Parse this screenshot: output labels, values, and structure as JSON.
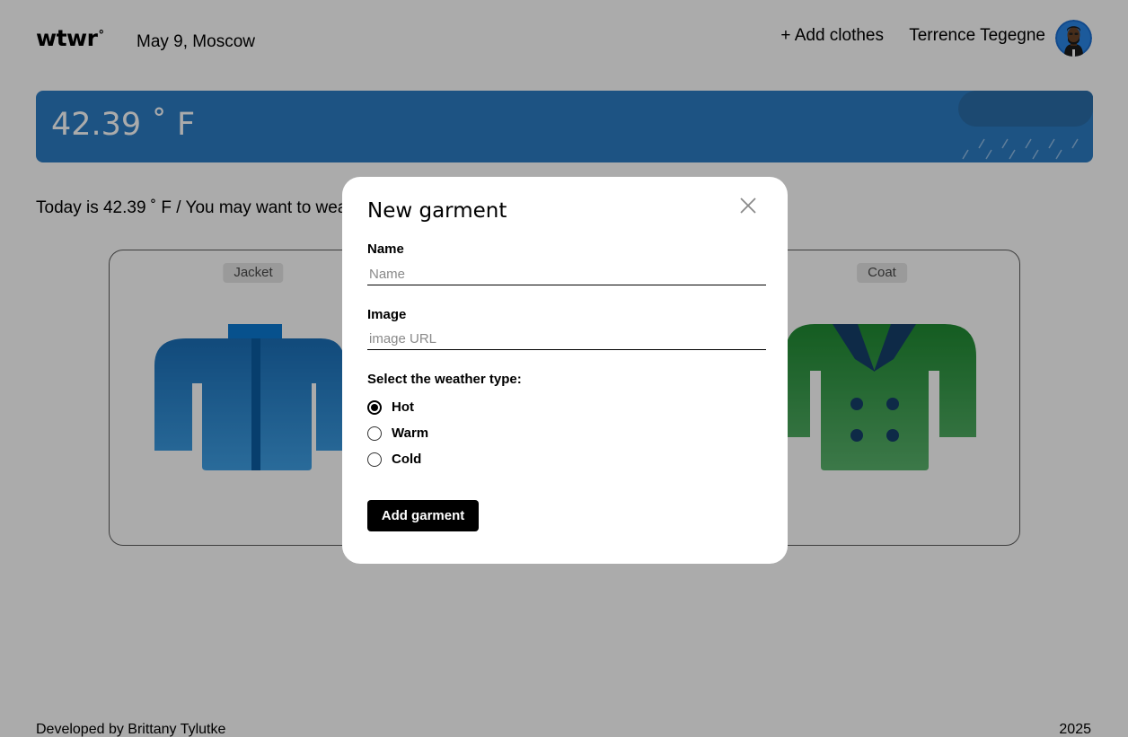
{
  "header": {
    "logo_text": "wtwr",
    "logo_degree": "°",
    "date_location": "May 9, Moscow",
    "add_clothes_label": "+ Add clothes",
    "username": "Terrence Tegegne"
  },
  "weather": {
    "temperature": "42.39 ˚ F"
  },
  "main": {
    "today_text": "Today is 42.39 ˚ F / You may want to wear:",
    "cards": [
      {
        "name": "Jacket"
      },
      {
        "name": "Coat"
      }
    ]
  },
  "footer": {
    "developer": "Developed by Brittany Tylutke",
    "year": "2025"
  },
  "modal": {
    "title": "New garment",
    "name_label": "Name",
    "name_placeholder": "Name",
    "name_value": "",
    "image_label": "Image",
    "image_placeholder": "image URL",
    "image_value": "",
    "weather_label": "Select the weather type:",
    "options": [
      {
        "label": "Hot",
        "checked": true
      },
      {
        "label": "Warm",
        "checked": false
      },
      {
        "label": "Cold",
        "checked": false
      }
    ],
    "submit_label": "Add garment"
  },
  "colors": {
    "weather_card": "#2c7cc4",
    "jacket": "#3fa0e6",
    "coat": "#2a9b3e",
    "overlay": "rgba(0,0,0,0.33)"
  },
  "icons": {
    "close": "close-icon",
    "avatar": "avatar-image"
  }
}
